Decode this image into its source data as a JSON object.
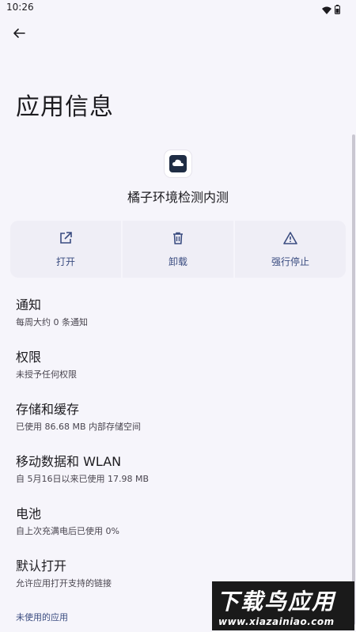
{
  "status_bar": {
    "time": "10:26"
  },
  "header": {
    "title": "应用信息"
  },
  "app": {
    "name": "橘子环境检测内测"
  },
  "actions": [
    {
      "label": "打开",
      "icon": "open-external-icon"
    },
    {
      "label": "卸载",
      "icon": "trash-icon"
    },
    {
      "label": "强行停止",
      "icon": "warning-icon"
    }
  ],
  "settings": [
    {
      "title": "通知",
      "subtitle": "每周大约 0 条通知"
    },
    {
      "title": "权限",
      "subtitle": "未授予任何权限"
    },
    {
      "title": "存储和缓存",
      "subtitle": "已使用 86.68 MB 内部存储空间"
    },
    {
      "title": "移动数据和 WLAN",
      "subtitle": "自 5月16日以来已使用 17.98 MB"
    },
    {
      "title": "电池",
      "subtitle": "自上次充满电后已使用 0%"
    },
    {
      "title": "默认打开",
      "subtitle": "允许应用打开支持的链接"
    }
  ],
  "unused_apps": {
    "label": "未使用的应用"
  },
  "watermark": {
    "big": "下载鸟应用",
    "small": "www.xiazainiao.com"
  },
  "colors": {
    "accent": "#3a4c80",
    "background": "#f6f5fb",
    "card": "#efeef6"
  }
}
